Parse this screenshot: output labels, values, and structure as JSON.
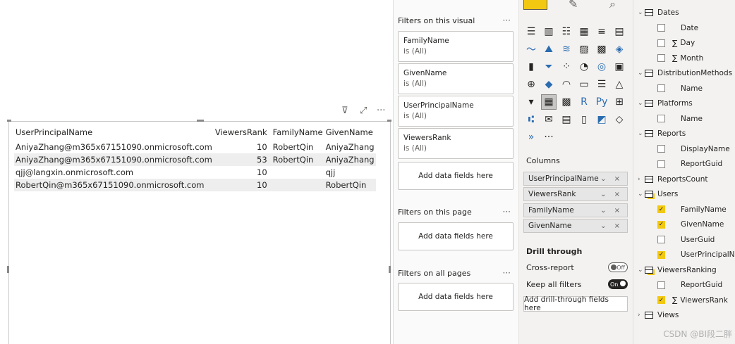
{
  "visual": {
    "table": {
      "columns": [
        "UserPrincipalName",
        "ViewersRank",
        "FamilyName",
        "GivenName"
      ],
      "rows": [
        [
          "AniyaZhang@m365x67151090.onmicrosoft.com",
          "10",
          "RobertQin",
          "AniyaZhang"
        ],
        [
          "AniyaZhang@m365x67151090.onmicrosoft.com",
          "53",
          "RobertQin",
          "AniyaZhang"
        ],
        [
          "qjj@langxin.onmicrosoft.com",
          "10",
          "",
          "qjj"
        ],
        [
          "RobertQin@m365x67151090.onmicrosoft.com",
          "10",
          "",
          "RobertQin"
        ]
      ]
    },
    "toolbar": {
      "filter_icon": "filter-icon",
      "focus_icon": "focus-mode-icon",
      "more_icon": "more-options-icon",
      "more_label": "···"
    }
  },
  "filters": {
    "visual_title": "Filters on this visual",
    "visual_cards": [
      {
        "name": "FamilyName",
        "value": "is (All)"
      },
      {
        "name": "GivenName",
        "value": "is (All)"
      },
      {
        "name": "UserPrincipalName",
        "value": "is (All)"
      },
      {
        "name": "ViewersRank",
        "value": "is (All)"
      }
    ],
    "add_label": "Add data fields here",
    "page_title": "Filters on this page",
    "all_title": "Filters on all pages",
    "dots": "···"
  },
  "viz": {
    "columns_title": "Columns",
    "wells": [
      "UserPrincipalName",
      "ViewersRank",
      "FamilyName",
      "GivenName"
    ],
    "well_controls": "⌄ ×",
    "drill_title": "Drill through",
    "cross_report": "Cross-report",
    "cross_state": "Off",
    "keep_filters": "Keep all filters",
    "keep_state": "On",
    "add_drill": "Add drill-through fields here",
    "more": "···"
  },
  "fields": {
    "items": [
      {
        "kind": "table",
        "label": "Dates",
        "expanded": true
      },
      {
        "kind": "field",
        "label": "Date",
        "checked": false,
        "sigma": false
      },
      {
        "kind": "field",
        "label": "Day",
        "checked": false,
        "sigma": true
      },
      {
        "kind": "field",
        "label": "Month",
        "checked": false,
        "sigma": true
      },
      {
        "kind": "table",
        "label": "DistributionMethods",
        "expanded": true
      },
      {
        "kind": "field",
        "label": "Name",
        "checked": false,
        "sigma": false
      },
      {
        "kind": "table",
        "label": "Platforms",
        "expanded": true
      },
      {
        "kind": "field",
        "label": "Name",
        "checked": false,
        "sigma": false
      },
      {
        "kind": "table",
        "label": "Reports",
        "expanded": true
      },
      {
        "kind": "field",
        "label": "DisplayName",
        "checked": false,
        "sigma": false
      },
      {
        "kind": "field",
        "label": "ReportGuid",
        "checked": false,
        "sigma": false
      },
      {
        "kind": "table",
        "label": "ReportsCount",
        "expanded": false
      },
      {
        "kind": "table",
        "label": "Users",
        "expanded": true,
        "used": true
      },
      {
        "kind": "field",
        "label": "FamilyName",
        "checked": true,
        "sigma": false
      },
      {
        "kind": "field",
        "label": "GivenName",
        "checked": true,
        "sigma": false
      },
      {
        "kind": "field",
        "label": "UserGuid",
        "checked": false,
        "sigma": false
      },
      {
        "kind": "field",
        "label": "UserPrincipalNa...",
        "checked": true,
        "sigma": false
      },
      {
        "kind": "table",
        "label": "ViewersRanking",
        "expanded": true,
        "used": true
      },
      {
        "kind": "field",
        "label": "ReportGuid",
        "checked": false,
        "sigma": false
      },
      {
        "kind": "field",
        "label": "ViewersRank",
        "checked": true,
        "sigma": true
      },
      {
        "kind": "table",
        "label": "Views",
        "expanded": false
      }
    ],
    "watermark": "CSDN @BI段二胖"
  },
  "colors": {
    "accent": "#f2c811",
    "pane_bg": "#f3f2f1",
    "row_band": "#eeeeee"
  }
}
